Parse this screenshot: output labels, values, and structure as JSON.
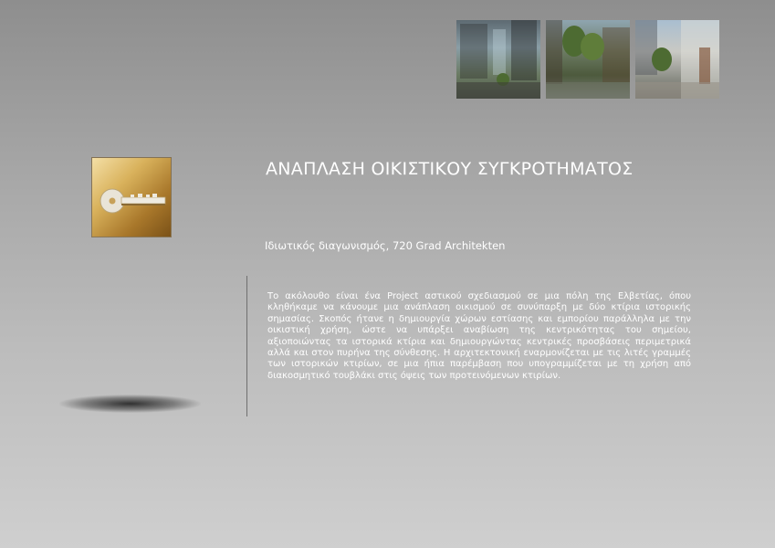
{
  "header": {
    "images": [
      {
        "name": "shopping-arcade-render"
      },
      {
        "name": "courtyard-trees-render"
      },
      {
        "name": "street-facades-render"
      }
    ]
  },
  "icon": {
    "name": "key-icon",
    "colors": {
      "light": "#f4dfa6",
      "mid": "#d9b25c",
      "dark": "#7b5218"
    }
  },
  "project": {
    "title": "ΑΝΑΠΛΑΣΗ ΟΙΚΙΣΤΙΚΟΥ ΣΥΓΚΡΟΤΗΜΑΤΟΣ",
    "subtitle": "Ιδιωτικός διαγωνισμός, 720 Grad Architekten",
    "description": "Το ακόλουθο είναι ένα Project αστικού σχεδιασμού σε μια πόλη της Ελβετίας, όπου κληθήκαμε να κάνουμε μια ανάπλαση οικισμού σε συνύπαρξη με δύο κτίρια ιστορικής σημασίας. Σκοπός ήτανε η δημιουργία χώρων εστίασης και εμπορίου παράλληλα με την οικιστική χρήση, ώστε να υπάρξει αναβίωση της κεντρικότητας του σημείου, αξιοποιώντας τα ιστορικά κτίρια και δημιουργώντας κεντρικές προσβάσεις περιμετρικά αλλά και στον πυρήνα της σύνθεσης. Η αρχιτεκτονική εναρμονίζεται με τις λιτές γραμμές των ιστορικών κτιρίων, σε μια ήπια παρέμβαση που υπογραμμίζεται με τη χρήση από διακοσμητικό τουβλάκι στις όψεις των προτεινόμενων κτιρίων."
  }
}
